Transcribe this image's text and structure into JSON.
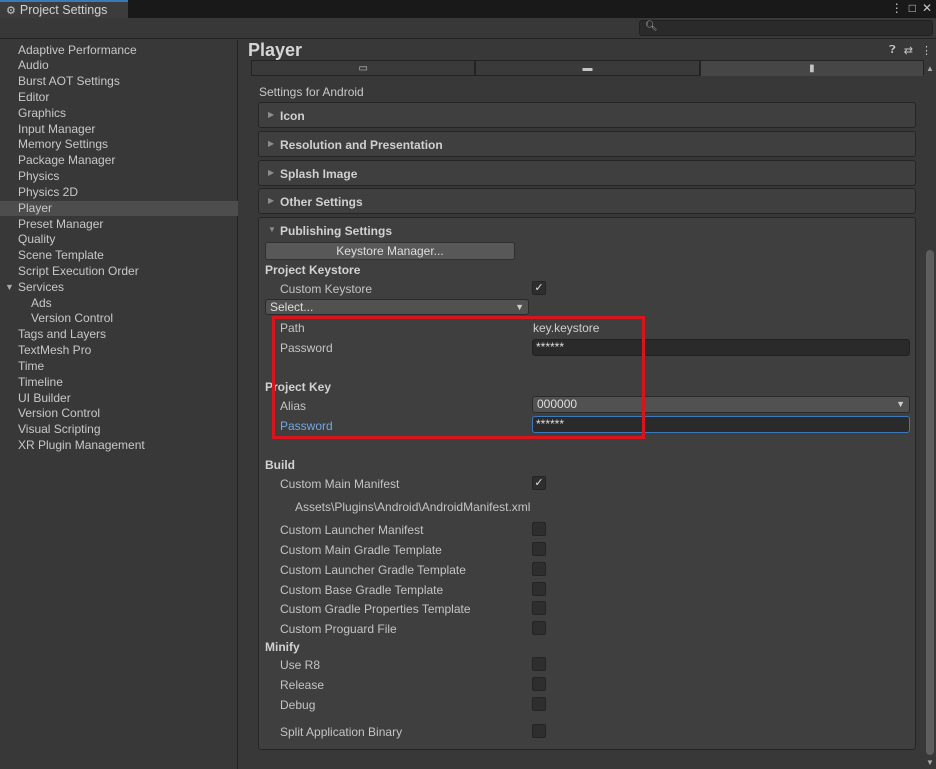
{
  "window": {
    "tab_title": "Project Settings",
    "controls": [
      "⋮",
      "□",
      "✕"
    ]
  },
  "sidebar": {
    "items": [
      {
        "label": "Adaptive Performance"
      },
      {
        "label": "Audio"
      },
      {
        "label": "Burst AOT Settings"
      },
      {
        "label": "Editor"
      },
      {
        "label": "Graphics"
      },
      {
        "label": "Input Manager"
      },
      {
        "label": "Memory Settings"
      },
      {
        "label": "Package Manager"
      },
      {
        "label": "Physics"
      },
      {
        "label": "Physics 2D"
      },
      {
        "label": "Player",
        "selected": true
      },
      {
        "label": "Preset Manager"
      },
      {
        "label": "Quality"
      },
      {
        "label": "Scene Template"
      },
      {
        "label": "Script Execution Order"
      },
      {
        "label": "Services",
        "expanded": true
      },
      {
        "label": "Ads",
        "sub": true
      },
      {
        "label": "Version Control",
        "sub": true
      },
      {
        "label": "Tags and Layers"
      },
      {
        "label": "TextMesh Pro"
      },
      {
        "label": "Time"
      },
      {
        "label": "Timeline"
      },
      {
        "label": "UI Builder"
      },
      {
        "label": "Version Control"
      },
      {
        "label": "Visual Scripting"
      },
      {
        "label": "XR Plugin Management"
      }
    ]
  },
  "main": {
    "title": "Player",
    "settings_for": "Settings for Android",
    "platform_tabs": [
      "standalone-icon",
      "webgl-icon",
      "android-icon"
    ],
    "sections": [
      {
        "label": "Icon"
      },
      {
        "label": "Resolution and Presentation"
      },
      {
        "label": "Splash Image"
      },
      {
        "label": "Other Settings"
      }
    ],
    "publishing": {
      "label": "Publishing Settings",
      "keystore_manager": "Keystore Manager...",
      "project_keystore": "Project Keystore",
      "custom_keystore": "Custom Keystore",
      "custom_keystore_checked": true,
      "select": "Select...",
      "path_label": "Path",
      "path_value": "key.keystore",
      "password_label": "Password",
      "password_value": "******",
      "project_key": "Project Key",
      "alias_label": "Alias",
      "alias_value": "000000",
      "key_password_label": "Password",
      "key_password_value": "******"
    },
    "build": {
      "label": "Build",
      "custom_main_manifest": "Custom Main Manifest",
      "custom_main_manifest_checked": true,
      "manifest_path": "Assets\\Plugins\\Android\\AndroidManifest.xml",
      "custom_launcher_manifest": "Custom Launcher Manifest",
      "custom_main_gradle": "Custom Main Gradle Template",
      "custom_launcher_gradle": "Custom Launcher Gradle Template",
      "custom_base_gradle": "Custom Base Gradle Template",
      "custom_gradle_properties": "Custom Gradle Properties Template",
      "custom_proguard": "Custom Proguard File"
    },
    "minify": {
      "label": "Minify",
      "use_r8": "Use R8",
      "release": "Release",
      "debug": "Debug"
    },
    "split_binary": "Split Application Binary"
  },
  "colors": {
    "accent": "#3a79bb",
    "highlight_box": "#d8141c"
  }
}
